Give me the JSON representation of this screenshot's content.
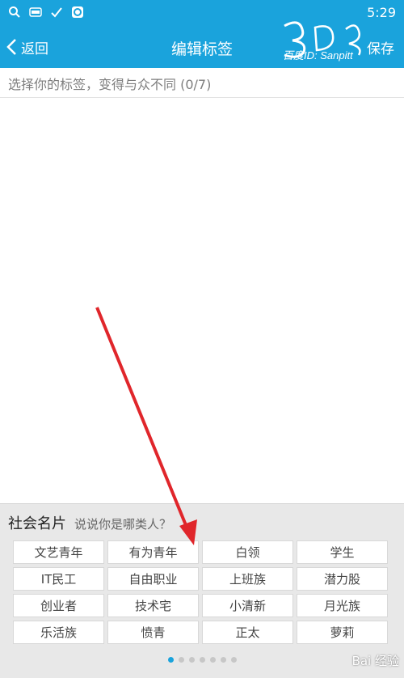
{
  "status_bar": {
    "time": "5:29"
  },
  "nav": {
    "back_label": "返回",
    "title": "编辑标签",
    "save_label": "保存"
  },
  "watermark": {
    "text": "百度ID: Sanpitt"
  },
  "hint": {
    "text": "选择你的标签，变得与众不同 (0/7)"
  },
  "panel": {
    "title": "社会名片",
    "subtitle": "说说你是哪类人？",
    "tags": [
      "文艺青年",
      "有为青年",
      "白领",
      "学生",
      "IT民工",
      "自由职业",
      "上班族",
      "潜力股",
      "创业者",
      "技术宅",
      "小清新",
      "月光族",
      "乐活族",
      "愤青",
      "正太",
      "萝莉"
    ],
    "pager": {
      "count": 7,
      "active_index": 0
    }
  },
  "baidu_mark": {
    "text": "Bai 经验"
  },
  "colors": {
    "brand": "#1aa3dc",
    "annotation_arrow": "#e0262b"
  }
}
